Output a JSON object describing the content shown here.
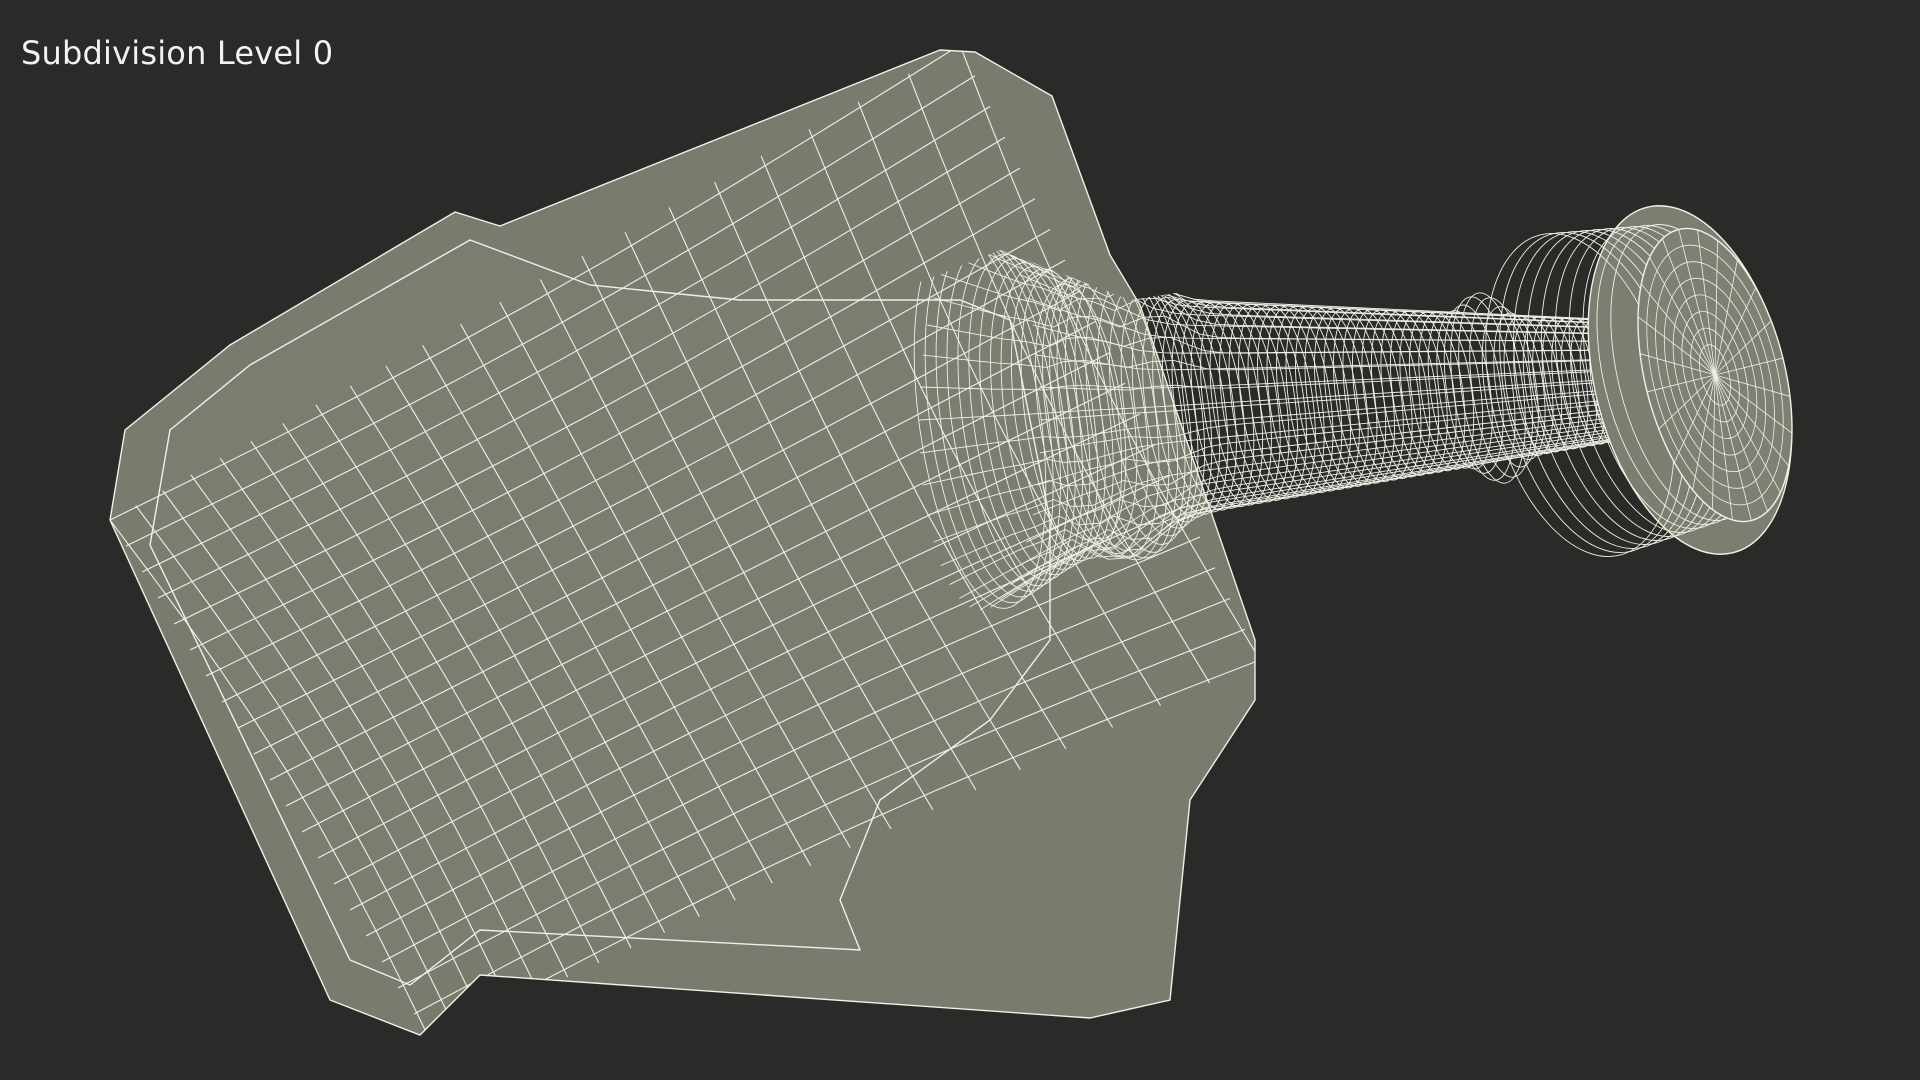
{
  "viewport": {
    "label": "Subdivision Level 0",
    "background": "#2a2a29",
    "mesh_fill": "#7a7b6f",
    "mesh_fill_light": "#85867a",
    "wire_color": "#f0f0e6"
  },
  "model": {
    "icon": "wireframe-bottle-mesh"
  }
}
